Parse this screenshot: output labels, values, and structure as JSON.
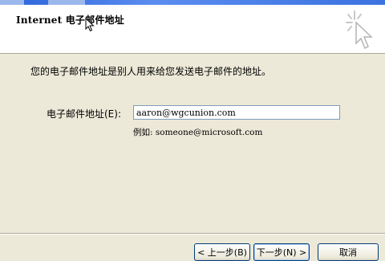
{
  "header": {
    "title": "Internet 电子邮件地址"
  },
  "body": {
    "description": "您的电子邮件地址是别人用来给您发送电子邮件的地址。",
    "email_label": "电子邮件地址(E):",
    "email_value": "aaron@wgcunion.com",
    "example_text": "例如: someone@microsoft.com"
  },
  "buttons": {
    "back": "< 上一步(B)",
    "next": "下一步(N) >",
    "cancel": "取消"
  },
  "colors": {
    "window_face": "#ece9d8",
    "header_bg": "#ffffff",
    "input_border": "#7f9db9",
    "button_border": "#003c74"
  },
  "icons": {
    "wizard_art": "wizard-sparkle-cursor-icon",
    "mouse_pointer": "mouse-pointer-icon"
  }
}
